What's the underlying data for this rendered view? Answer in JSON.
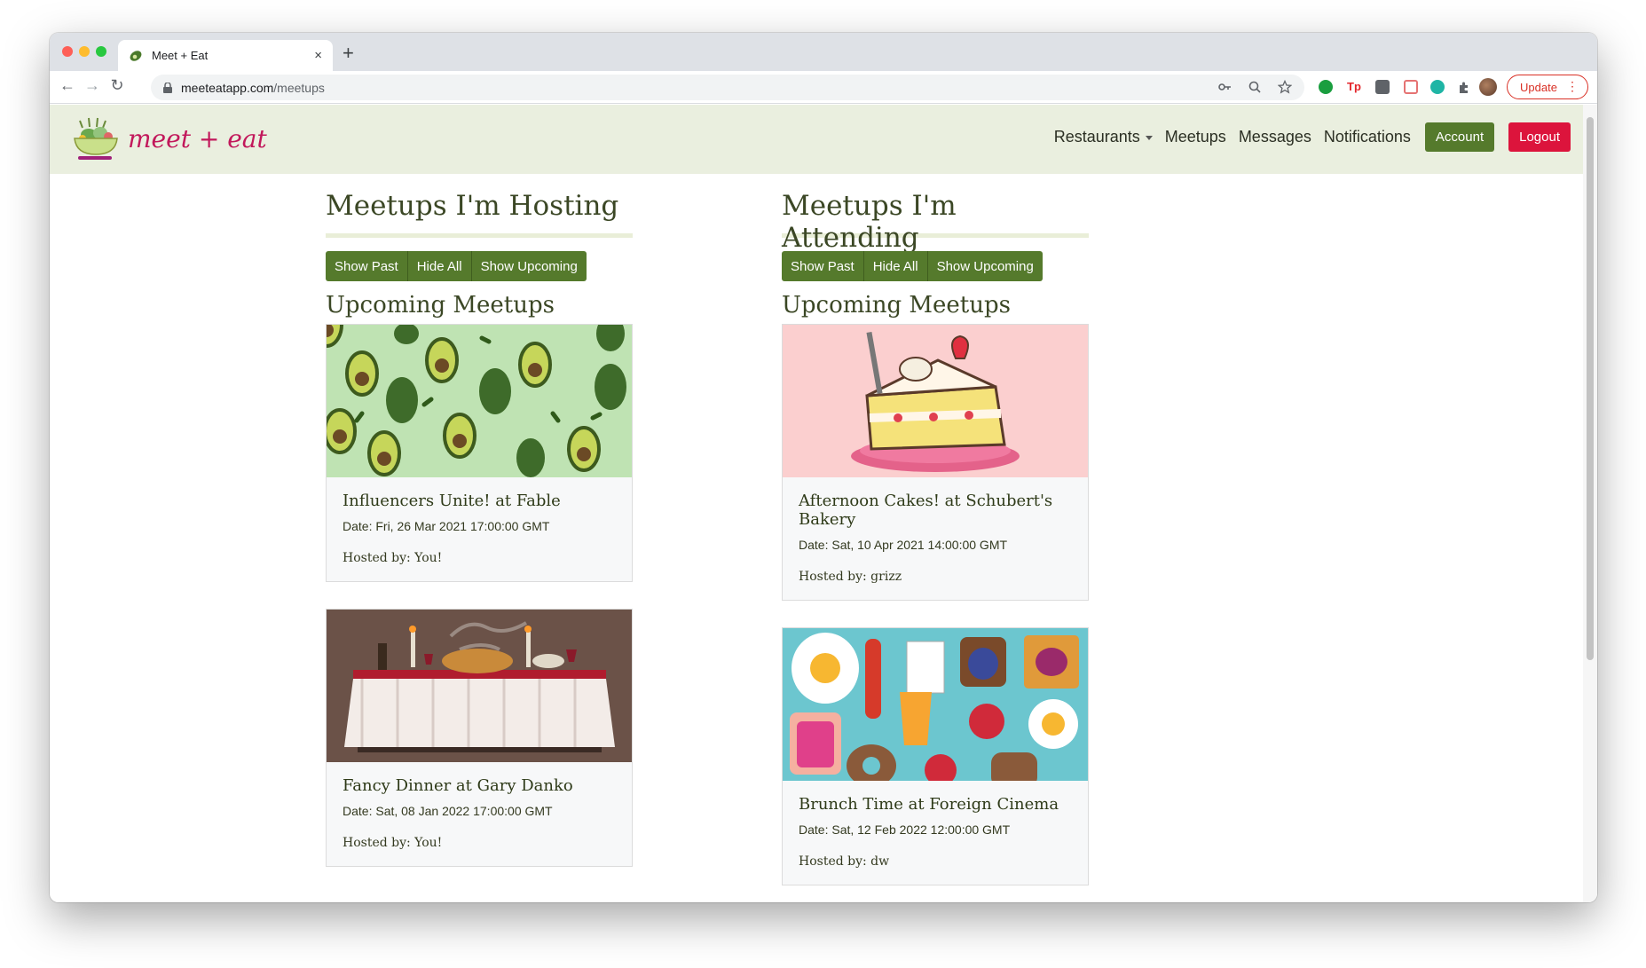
{
  "browser": {
    "tab_title": "Meet + Eat",
    "tab_close": "×",
    "new_tab": "+",
    "url_host": "meeteatapp.com",
    "url_path": "/meetups",
    "update_label": "Update",
    "update_menu": "⋮",
    "back": "←",
    "forward": "→",
    "reload": "↻"
  },
  "navbar": {
    "logo_text": "meet + eat",
    "links": [
      "Restaurants",
      "Meetups",
      "Messages",
      "Notifications"
    ],
    "account_label": "Account",
    "logout_label": "Logout"
  },
  "hosting": {
    "title": "Meetups I'm Hosting",
    "filters": [
      "Show Past",
      "Hide All",
      "Show Upcoming"
    ],
    "section": "Upcoming Meetups",
    "cards": [
      {
        "title": "Influencers Unite! at Fable",
        "date": "Date: Fri, 26 Mar 2021 17:00:00 GMT",
        "host": "Hosted by: You!",
        "image": "avocado-pattern"
      },
      {
        "title": "Fancy Dinner at Gary Danko",
        "date": "Date: Sat, 08 Jan 2022 17:00:00 GMT",
        "host": "Hosted by: You!",
        "image": "banquet-table"
      }
    ]
  },
  "attending": {
    "title": "Meetups I'm Attending",
    "filters": [
      "Show Past",
      "Hide All",
      "Show Upcoming"
    ],
    "section": "Upcoming Meetups",
    "cards": [
      {
        "title": "Afternoon Cakes! at Schubert's Bakery",
        "date": "Date: Sat, 10 Apr 2021 14:00:00 GMT",
        "host": "Hosted by: grizz",
        "image": "cake-slice"
      },
      {
        "title": "Brunch Time at Foreign Cinema",
        "date": "Date: Sat, 12 Feb 2022 12:00:00 GMT",
        "host": "Hosted by: dw",
        "image": "breakfast-pattern"
      }
    ]
  },
  "colors": {
    "brand_green": "#557a2c",
    "logout_red": "#dc143c",
    "navbar_bg": "#eaefdf",
    "title_text": "#3b4725"
  }
}
